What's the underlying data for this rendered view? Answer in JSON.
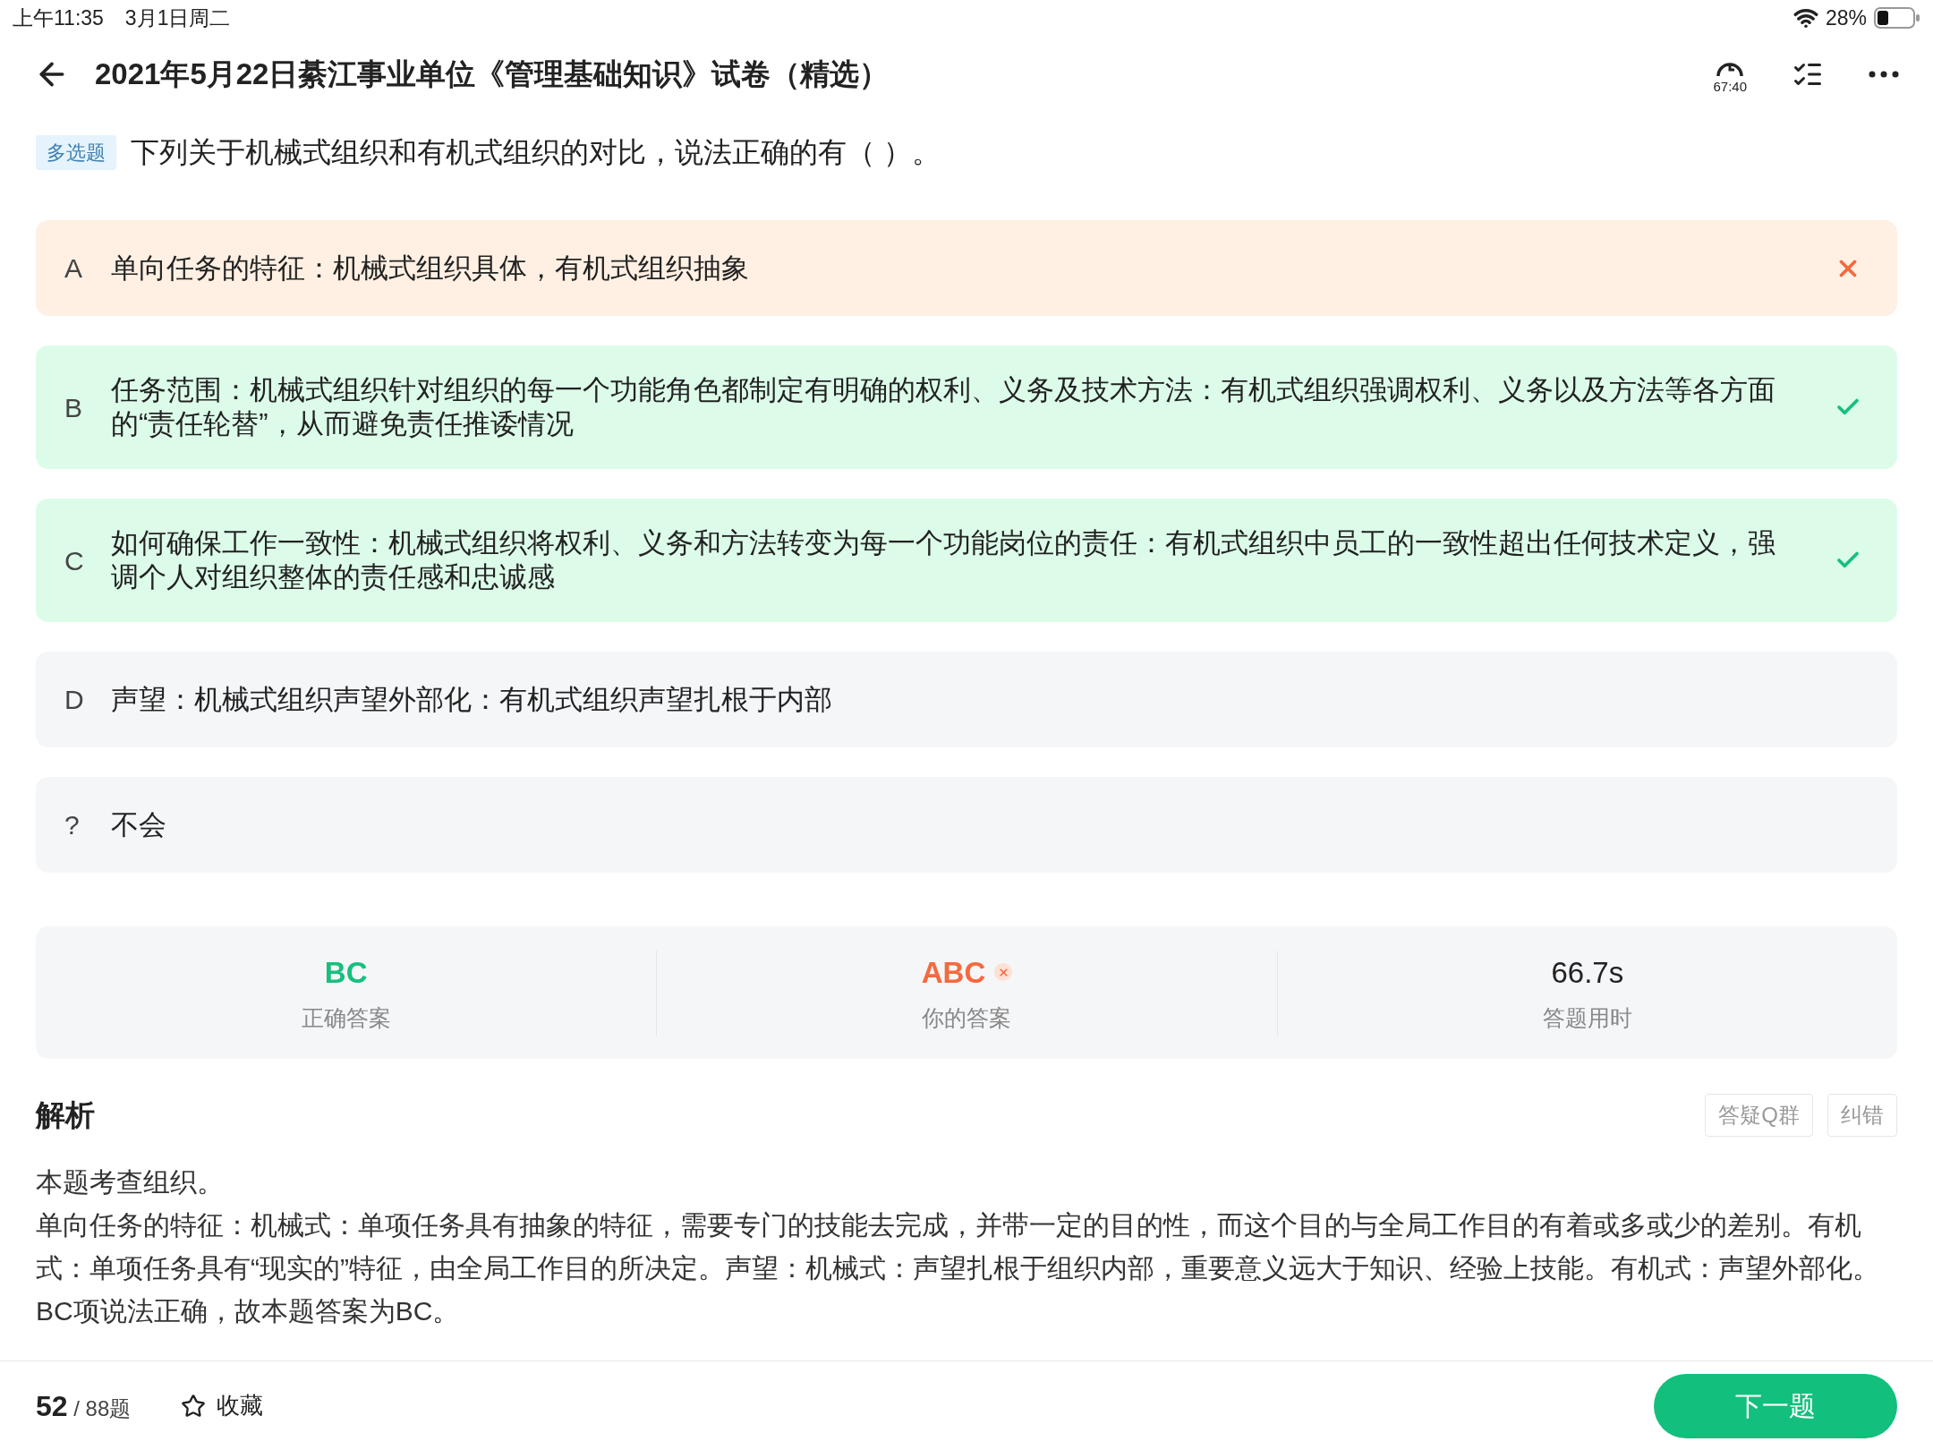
{
  "status_bar": {
    "time": "上午11:35",
    "date": "3月1日周二",
    "battery": "28%"
  },
  "header": {
    "title": "2021年5月22日綦江事业单位《管理基础知识》试卷（精选）",
    "timer": "67:40"
  },
  "question": {
    "tag": "多选题",
    "text": "下列关于机械式组织和有机式组织的对比，说法正确的有（ ）。"
  },
  "options": [
    {
      "letter": "A",
      "text": "单向任务的特征：机械式组织具体，有机式组织抽象",
      "kind": "wrong"
    },
    {
      "letter": "B",
      "text": "任务范围：机械式组织针对组织的每一个功能角色都制定有明确的权利、义务及技术方法：有机式组织强调权利、义务以及方法等各方面的“责任轮替”，从而避免责任推诿情况",
      "kind": "correct"
    },
    {
      "letter": "C",
      "text": "如何确保工作一致性：机械式组织将权利、义务和方法转变为每一个功能岗位的责任：有机式组织中员工的一致性超出任何技术定义，强调个人对组织整体的责任感和忠诚感",
      "kind": "correct"
    },
    {
      "letter": "D",
      "text": "声望：机械式组织声望外部化：有机式组织声望扎根于内部",
      "kind": "none"
    },
    {
      "letter": "?",
      "text": "不会",
      "kind": "none"
    }
  ],
  "summary": [
    {
      "value": "BC",
      "label": "正确答案",
      "kind": "correct"
    },
    {
      "value": "ABC",
      "label": "你的答案",
      "kind": "wrong"
    },
    {
      "value": "66.7s",
      "label": "答题用时",
      "kind": "plain"
    }
  ],
  "analysis": {
    "title": "解析",
    "buttons": [
      "答疑Q群",
      "纠错"
    ],
    "paragraphs": [
      "本题考查组织。",
      "单向任务的特征：机械式：单项任务具有抽象的特征，需要专门的技能去完成，并带一定的目的性，而这个目的与全局工作目的有着或多或少的差别。有机式：单项任务具有“现实的”特征，由全局工作目的所决定。声望：机械式：声望扎根于组织内部，重要意义远大于知识、经验上技能。有机式：声望外部化。BC项说法正确，故本题答案为BC。"
    ]
  },
  "footer": {
    "current": "52",
    "total": "/ 88题",
    "favorite": "收藏",
    "next": "下一题"
  }
}
